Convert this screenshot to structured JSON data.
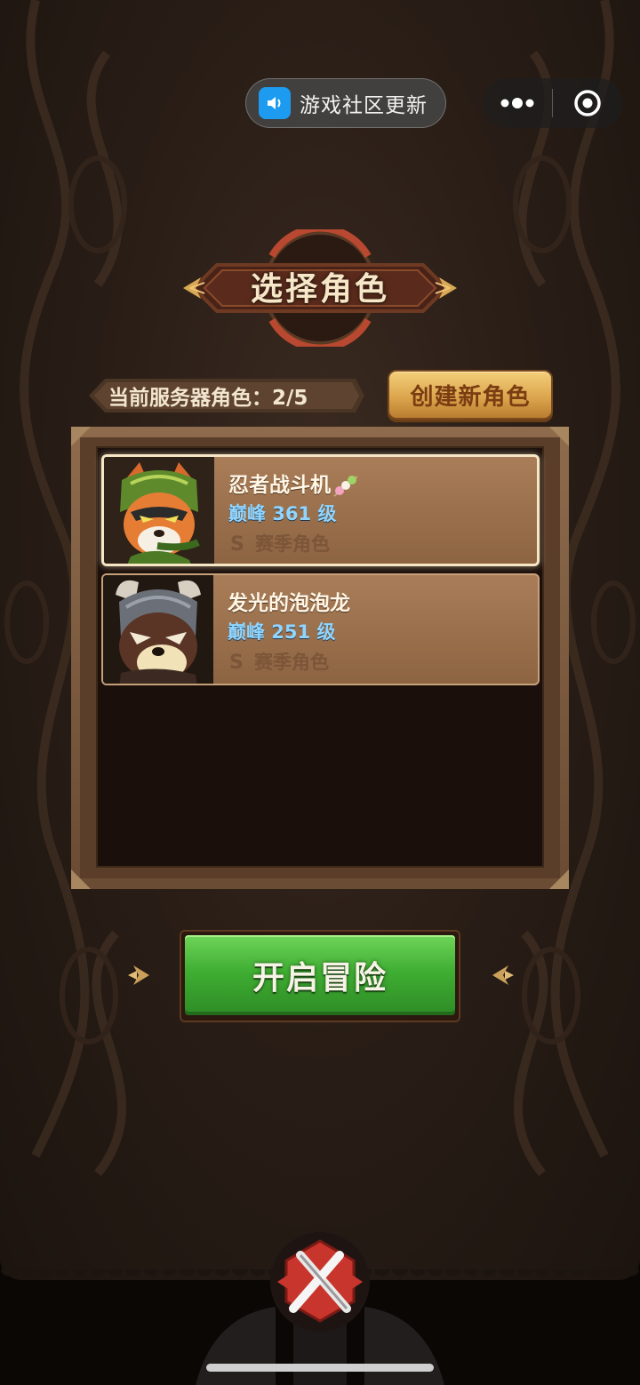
{
  "top_bar": {
    "community_label": "游戏社区更新"
  },
  "title": "选择角色",
  "server": {
    "label": "当前服务器角色：2/5"
  },
  "create_button_label": "创建新角色",
  "characters": [
    {
      "name": "忍者战斗机",
      "level": "巅峰 361 级",
      "season": "赛季角色",
      "selected": true
    },
    {
      "name": "发光的泡泡龙",
      "level": "巅峰 251 级",
      "season": "赛季角色",
      "selected": false
    }
  ],
  "start_button_label": "开启冒险",
  "colors": {
    "start_green": "#3fae32",
    "create_gold": "#d9a24a",
    "level_blue": "#8fd5ff",
    "card_brown": "#a97d58"
  }
}
